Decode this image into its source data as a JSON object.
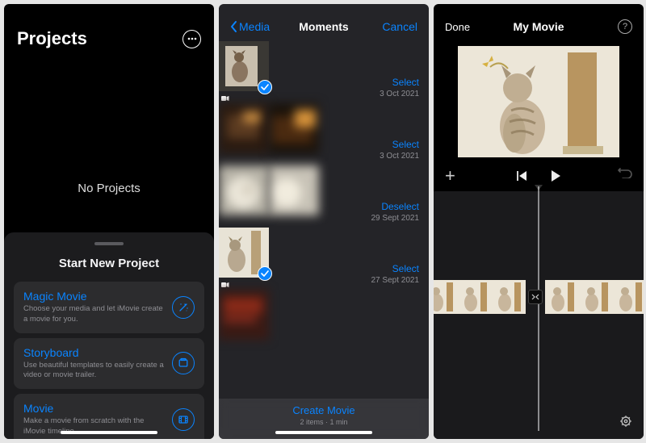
{
  "screen1": {
    "title": "Projects",
    "no_projects": "No Projects",
    "sheet_title": "Start New Project",
    "items": [
      {
        "title": "Magic Movie",
        "desc": "Choose your media and let iMovie create a movie for you."
      },
      {
        "title": "Storyboard",
        "desc": "Use beautiful templates to easily create a video or movie trailer."
      },
      {
        "title": "Movie",
        "desc": "Make a movie from scratch with the iMovie timeline."
      }
    ]
  },
  "screen2": {
    "back": "Media",
    "title": "Moments",
    "cancel": "Cancel",
    "moments": [
      {
        "action": "Select",
        "date": "3 Oct 2021",
        "selected": true,
        "video": true
      },
      {
        "action": "Select",
        "date": "3 Oct 2021",
        "selected": false,
        "video": false
      },
      {
        "action": "Deselect",
        "date": "29 Sept 2021",
        "selected": true,
        "video": true
      },
      {
        "action": "Select",
        "date": "27 Sept 2021",
        "selected": false,
        "video": false
      }
    ],
    "create": "Create Movie",
    "create_sub": "2 items · 1 min"
  },
  "screen3": {
    "done": "Done",
    "title": "My Movie"
  }
}
